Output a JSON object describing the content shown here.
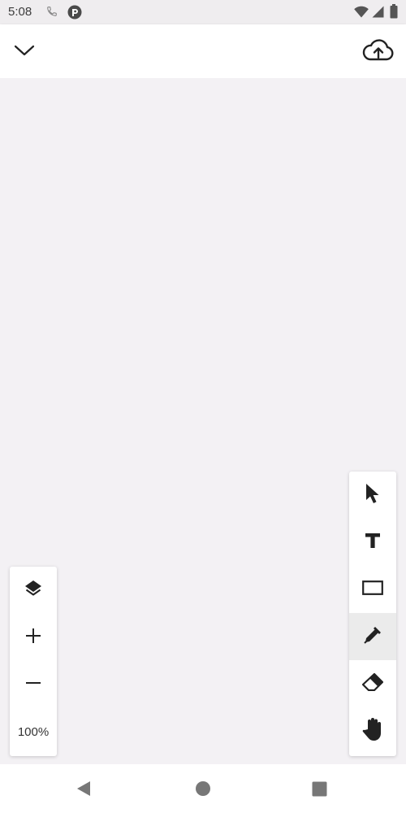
{
  "status_bar": {
    "time": "5:08",
    "icons": [
      "phone-icon",
      "app-notification-icon",
      "wifi-icon",
      "signal-icon",
      "battery-icon"
    ]
  },
  "app_bar": {
    "left_icon": "chevron-down-icon",
    "right_icon": "cloud-upload-icon"
  },
  "tools": [
    {
      "name": "select",
      "icon": "cursor-icon",
      "active": false
    },
    {
      "name": "text",
      "icon": "text-icon",
      "active": false
    },
    {
      "name": "rectangle",
      "icon": "rectangle-icon",
      "active": false
    },
    {
      "name": "pen",
      "icon": "pen-icon",
      "active": true
    },
    {
      "name": "eraser",
      "icon": "eraser-icon",
      "active": false
    },
    {
      "name": "pan",
      "icon": "hand-icon",
      "active": false
    }
  ],
  "zoom_panel": {
    "layers_icon": "layers-icon",
    "zoom_in_icon": "plus-icon",
    "zoom_out_icon": "minus-icon",
    "zoom_level": "100%"
  },
  "nav_bar": {
    "icons": [
      "back-icon",
      "home-icon",
      "recents-icon"
    ]
  },
  "colors": {
    "canvas": "#f3f1f4",
    "panel": "#ffffff",
    "active_tool": "#ebebeb",
    "icon": "#202124"
  }
}
